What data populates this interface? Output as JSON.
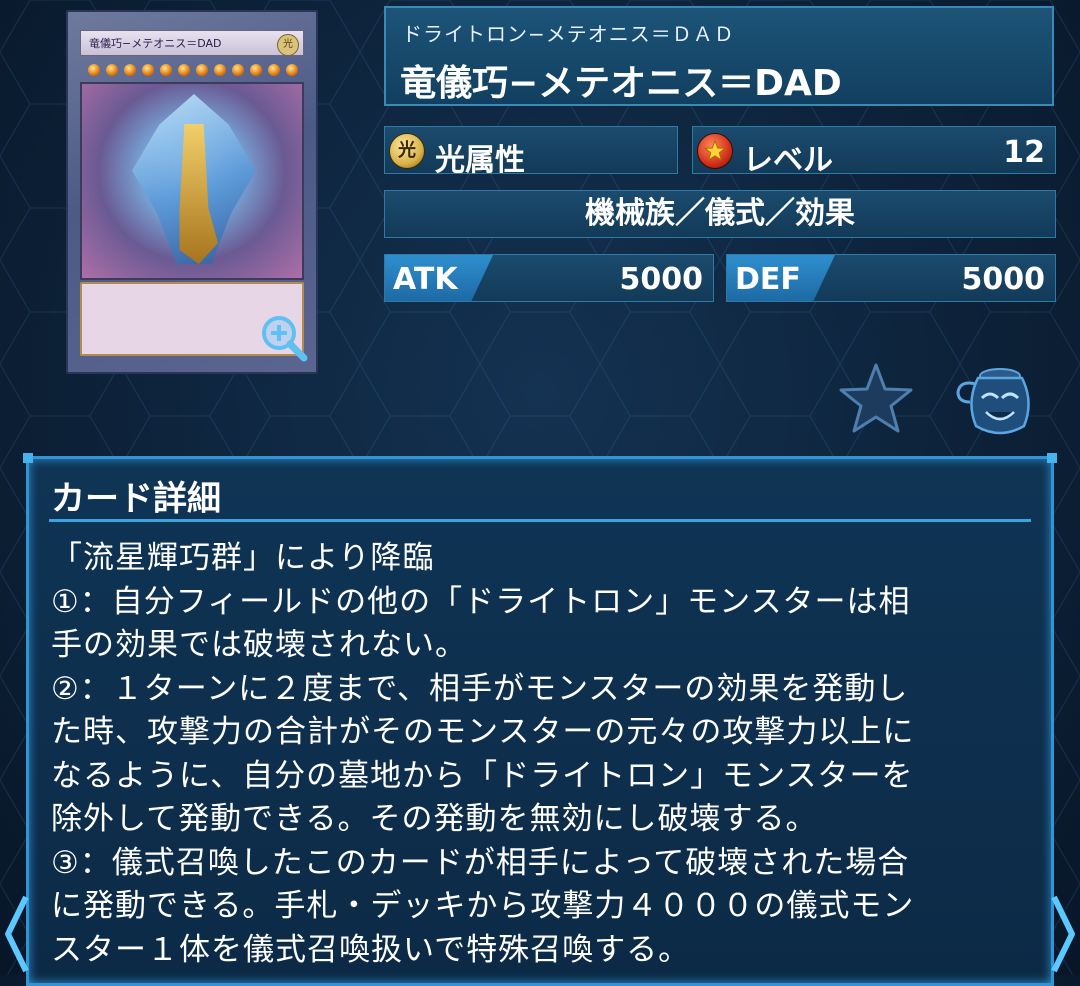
{
  "card": {
    "thumb_name": "竜儀巧−メテオニス＝DAD",
    "thumb_attribute": "光",
    "thumb_level": 12,
    "zoom_icon": "zoom-in-icon"
  },
  "name_panel": {
    "ruby": "ドライトロン−メテオニス＝ＤＡＤ",
    "name": "竜儀巧−メテオニス＝DAD"
  },
  "attribute": {
    "icon": "light-attribute-icon",
    "icon_glyph": "光",
    "label": "光属性"
  },
  "level": {
    "icon": "level-star-icon",
    "label": "レベル",
    "value": "12"
  },
  "type_line": "機械族／儀式／効果",
  "atk": {
    "label": "ATK",
    "value": "5000"
  },
  "def": {
    "label": "DEF",
    "value": "5000"
  },
  "actions": {
    "favorite_icon": "favorite-star-icon",
    "pot_icon": "pot-of-greed-icon"
  },
  "detail": {
    "title": "カード詳細",
    "lines": [
      "「流星輝巧群」により降臨",
      "①：自分フィールドの他の「ドライトロン」モンスターは相",
      "手の効果では破壊されない。",
      "②：１ターンに２度まで、相手がモンスターの効果を発動し",
      "た時、攻撃力の合計がそのモンスターの元々の攻撃力以上に",
      "なるように、自分の墓地から「ドライトロン」モンスターを",
      "除外して発動できる。その発動を無効にし破壊する。",
      "③：儀式召喚したこのカードが相手によって破壊された場合",
      "に発動できる。手札・デッキから攻撃力４０００の儀式モン",
      "スター１体を儀式召喚扱いで特殊召喚する。"
    ]
  },
  "colors": {
    "accent": "#2f95d4",
    "panel": "#133a58",
    "background": "#0c2035"
  }
}
